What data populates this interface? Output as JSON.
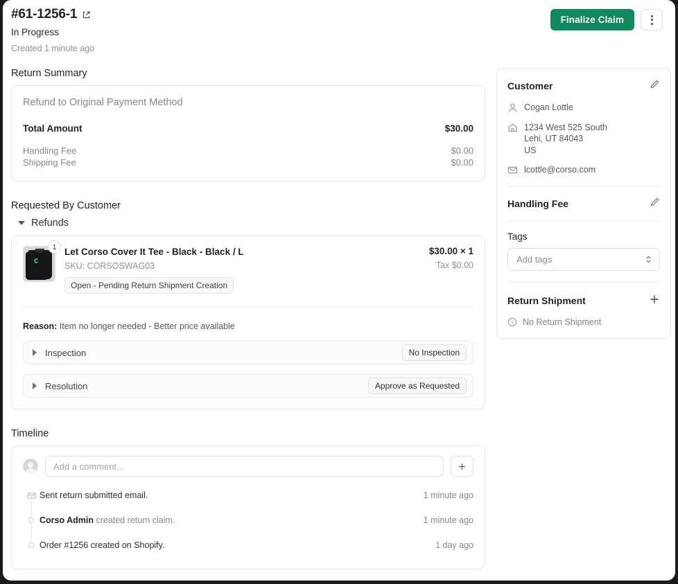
{
  "header": {
    "claim_number": "#61-1256-1",
    "external_link_icon": "external-link-icon",
    "status": "In Progress",
    "created": "Created 1 minute ago",
    "finalize_label": "Finalize Claim",
    "kebab_icon": "more-vertical-icon",
    "accent_green": "#11895e"
  },
  "return_summary": {
    "section_title": "Return Summary",
    "method": "Refund to Original Payment Method",
    "total_label": "Total Amount",
    "total_value": "$30.00",
    "fees": [
      {
        "label": "Handling Fee",
        "value": "$0.00"
      },
      {
        "label": "Shipping Fee",
        "value": "$0.00"
      }
    ]
  },
  "requested": {
    "section_title": "Requested By Customer",
    "group_label": "Refunds",
    "group_expanded": true,
    "item": {
      "quantity_badge": "1",
      "name": "Let Corso Cover It Tee - Black - Black / L",
      "sku": "SKU: CORSOSWAG03",
      "status_pill": "Open - Pending Return Shipment Creation",
      "price": "$30.00 × 1",
      "tax": "Tax $0.00",
      "reason_label": "Reason:",
      "reason_text": " Item no longer needed - Better price available"
    },
    "rows": [
      {
        "label": "Inspection",
        "tag": "No Inspection"
      },
      {
        "label": "Resolution",
        "tag": "Approve as Requested"
      }
    ]
  },
  "customer": {
    "title": "Customer",
    "edit_icon": "pencil-icon",
    "name": "Cogan Lottle",
    "address_line1": "1234 West 525 South",
    "address_line2": "Lehi, UT 84043",
    "address_line3": "US",
    "email": "lcottle@corso.com"
  },
  "handling_fee": {
    "title": "Handling Fee",
    "edit_icon": "pencil-icon"
  },
  "tags": {
    "title": "Tags",
    "placeholder": "Add tags"
  },
  "return_shipment": {
    "title": "Return Shipment",
    "add_icon": "plus-icon",
    "empty_text": "No Return Shipment"
  },
  "timeline": {
    "section_title": "Timeline",
    "comment_placeholder": "Add a comment...",
    "add_icon": "plus-icon",
    "entries": [
      {
        "icon": "mail-icon",
        "text": "Sent return submitted email.",
        "actor": "",
        "time": "1 minute ago"
      },
      {
        "icon": "dot-icon",
        "actor": "Corso Admin",
        "text": " created return claim.",
        "time": "1 minute ago"
      },
      {
        "icon": "dot-icon",
        "actor": "",
        "text": "Order #1256 created on Shopify.",
        "time": "1 day ago"
      }
    ]
  }
}
